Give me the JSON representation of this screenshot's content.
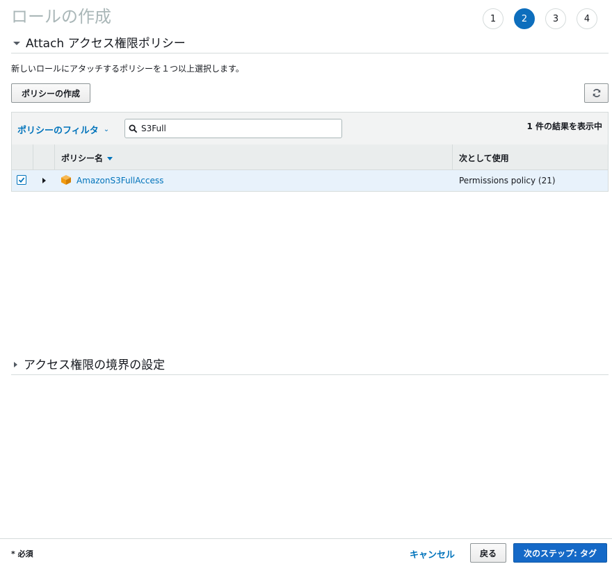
{
  "page": {
    "title": "ロールの作成"
  },
  "steps": [
    "1",
    "2",
    "3",
    "4"
  ],
  "active_step": "2",
  "attach_section": {
    "title": "Attach アクセス権限ポリシー",
    "description": "新しいロールにアタッチするポリシーを１つ以上選択します。",
    "create_policy_label": "ポリシーの作成",
    "refresh_icon": "refresh-icon"
  },
  "table": {
    "filter_label": "ポリシーのフィルタ",
    "search_value": "S3Full",
    "result_count": "1 件の結果を表示中",
    "columns": {
      "name": "ポリシー名",
      "used_as": "次として使用"
    },
    "rows": [
      {
        "checked": true,
        "name": "AmazonS3FullAccess",
        "used_as": "Permissions policy (21)",
        "icon": "aws-managed-policy-icon"
      }
    ]
  },
  "boundary_section": {
    "title": "アクセス権限の境界の設定"
  },
  "footer": {
    "required_note": "* 必須",
    "cancel_label": "キャンセル",
    "back_label": "戻る",
    "next_label": "次のステップ: タグ"
  },
  "colors": {
    "accent": "#0073bb",
    "primary_button": "#1569c7",
    "active_step": "#0d6ebd",
    "policy_icon": "#f29b10"
  }
}
